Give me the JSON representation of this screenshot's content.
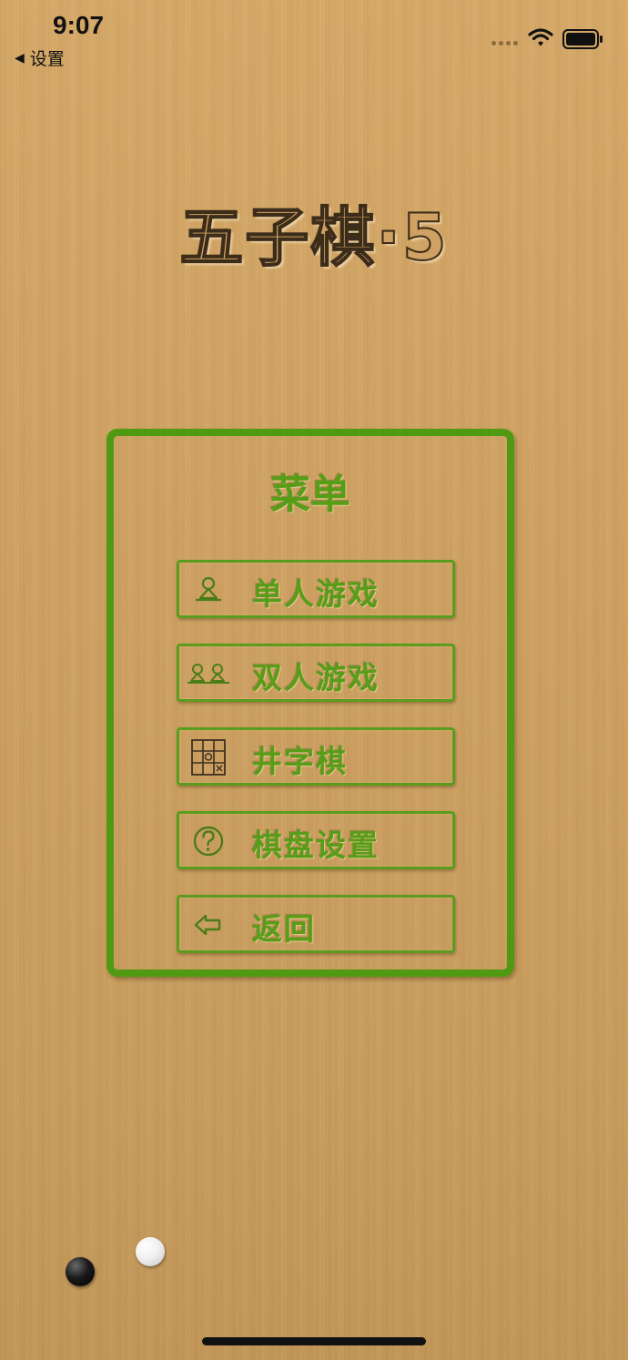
{
  "status_bar": {
    "time": "9:07",
    "back_label": "设置"
  },
  "title": "五子棋·5",
  "menu": {
    "title": "菜单",
    "items": [
      {
        "label": "单人游戏",
        "icon": "single-player-icon"
      },
      {
        "label": "双人游戏",
        "icon": "two-players-icon"
      },
      {
        "label": "井字棋",
        "icon": "tic-tac-toe-icon"
      },
      {
        "label": "棋盘设置",
        "icon": "help-icon"
      },
      {
        "label": "返回",
        "icon": "back-arrow-icon"
      }
    ]
  },
  "colors": {
    "accent_green": "#579d17",
    "border_green": "#4f9a12",
    "wood": "#cfa263"
  }
}
